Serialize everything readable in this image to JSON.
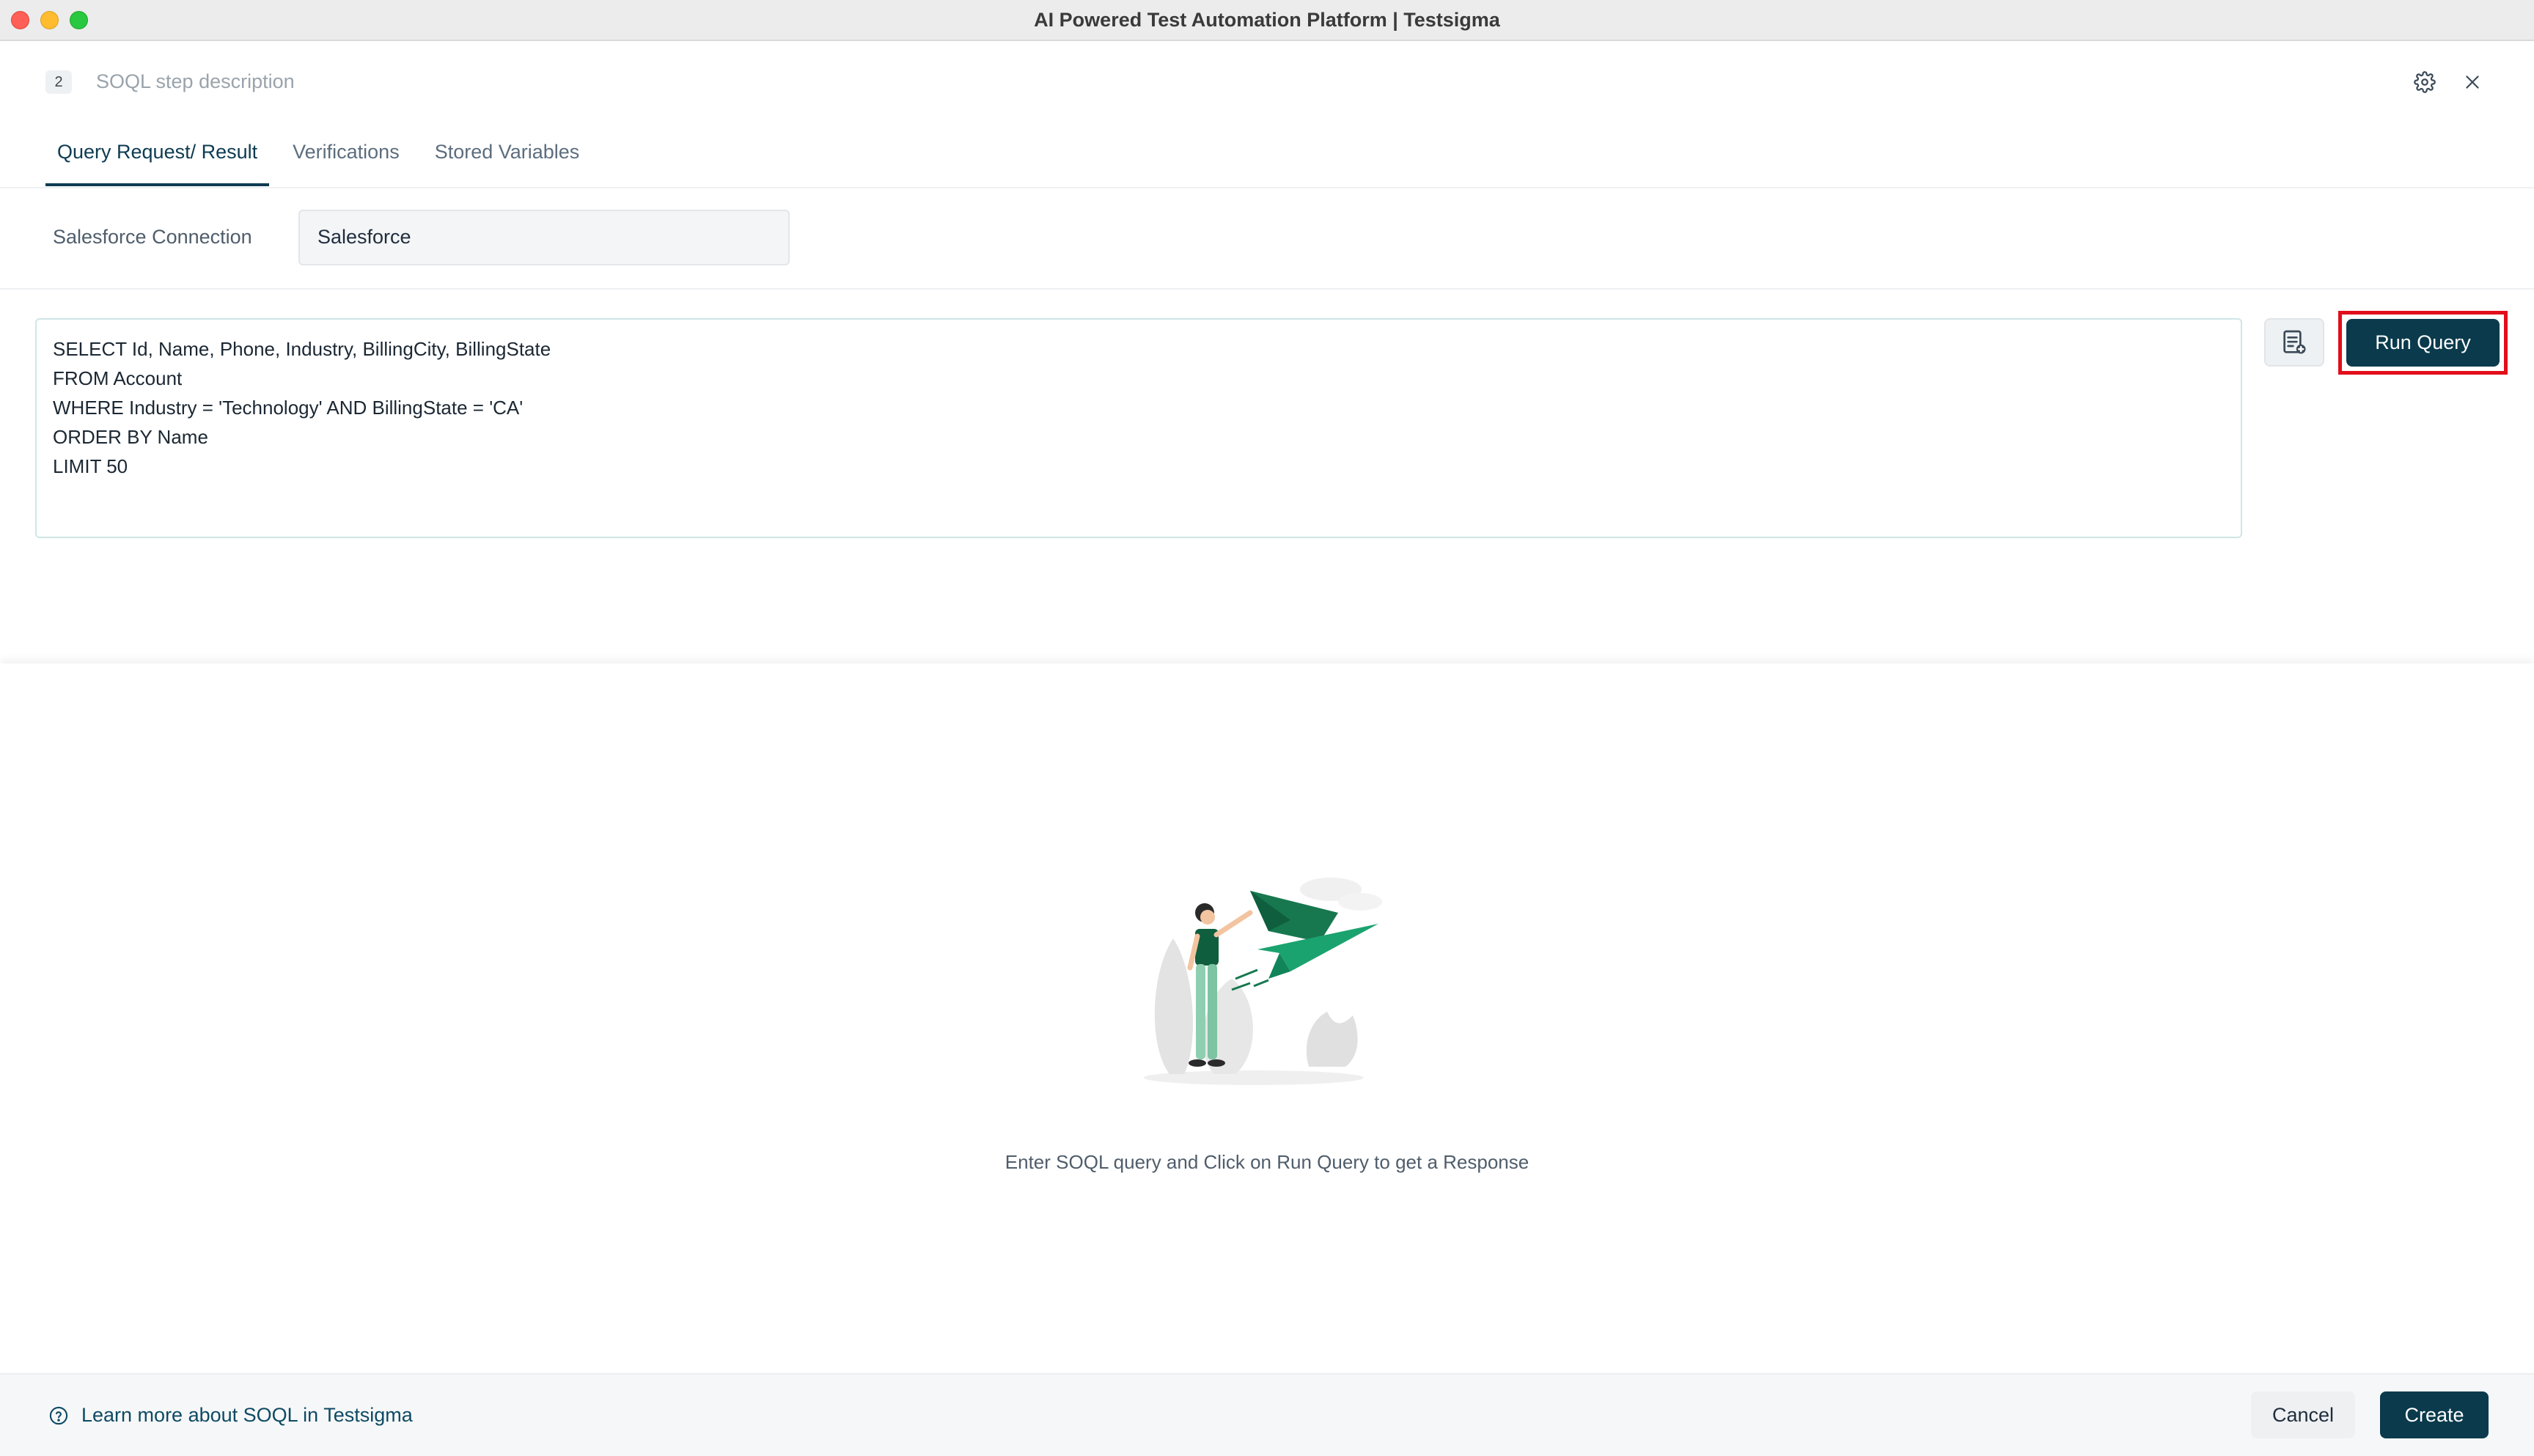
{
  "window": {
    "title": "AI Powered Test Automation Platform | Testsigma"
  },
  "header": {
    "step_number": "2",
    "step_description": "SOQL step description",
    "settings_icon": "gear-icon",
    "close_icon": "close-icon"
  },
  "tabs": [
    {
      "label": "Query Request/ Result",
      "active": true
    },
    {
      "label": "Verifications",
      "active": false
    },
    {
      "label": "Stored Variables",
      "active": false
    }
  ],
  "connection": {
    "label": "Salesforce Connection",
    "value": "Salesforce"
  },
  "query": {
    "lines": [
      "SELECT Id, Name, Phone, Industry, BillingCity, BillingState",
      "FROM Account",
      "WHERE Industry = 'Technology' AND BillingState = 'CA'",
      "ORDER BY Name",
      "LIMIT 50"
    ],
    "history_icon": "query-history-icon",
    "run_label": "Run Query"
  },
  "result": {
    "empty_message": "Enter SOQL query and Click on Run Query to get a Response"
  },
  "footer": {
    "help_icon": "help-circle-icon",
    "help_link": "Learn more about SOQL in Testsigma",
    "cancel_label": "Cancel",
    "create_label": "Create"
  },
  "colors": {
    "primary": "#0a3a4c",
    "highlight": "#e10e1b",
    "illustration_green": "#1aa36f"
  }
}
